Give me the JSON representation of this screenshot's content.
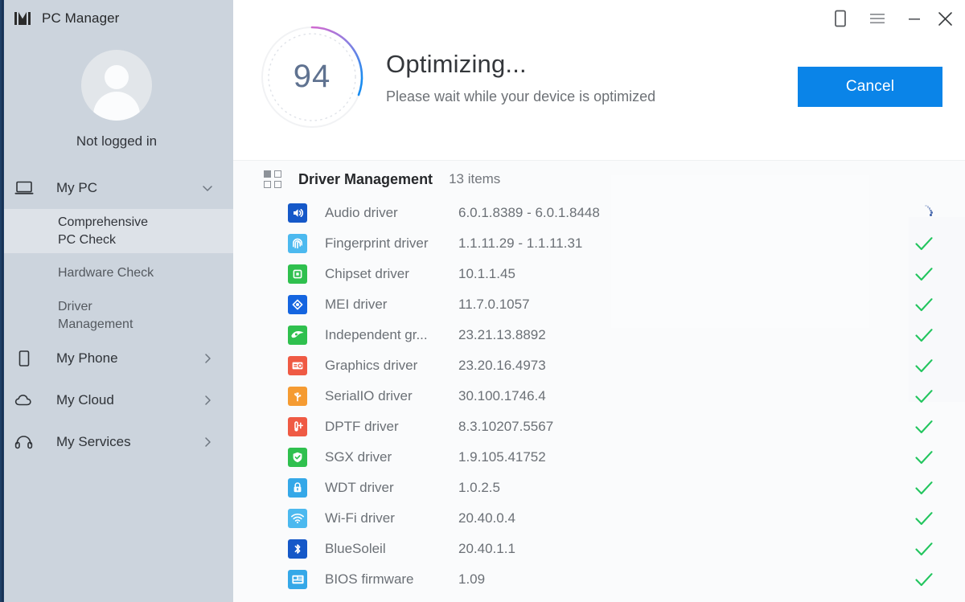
{
  "app": {
    "title": "PC Manager",
    "logo_icon": "pc-manager-logo-icon"
  },
  "window_controls": [
    {
      "name": "phone-icon",
      "label": "Phone"
    },
    {
      "name": "menu-icon",
      "label": "Menu"
    },
    {
      "name": "minimize-icon",
      "label": "Minimize"
    },
    {
      "name": "close-icon",
      "label": "Close"
    }
  ],
  "sidebar": {
    "profile": {
      "avatar_icon": "default-user-avatar",
      "status_text": "Not logged in"
    },
    "items": [
      {
        "label": "My PC",
        "icon": "laptop-icon",
        "chevron": "chevron-down-icon",
        "expanded": true,
        "children": [
          {
            "label": "Comprehensive PC Check",
            "active": true
          },
          {
            "label": "Hardware Check",
            "active": false
          },
          {
            "label": "Driver Management",
            "active": false
          }
        ]
      },
      {
        "label": "My Phone",
        "icon": "phone-icon",
        "chevron": "chevron-right-icon",
        "expanded": false,
        "children": []
      },
      {
        "label": "My Cloud",
        "icon": "cloud-icon",
        "chevron": "chevron-right-icon",
        "expanded": false,
        "children": []
      },
      {
        "label": "My Services",
        "icon": "headset-icon",
        "chevron": "chevron-right-icon",
        "expanded": false,
        "children": []
      }
    ]
  },
  "header": {
    "score": "94",
    "title": "Optimizing...",
    "subtitle": "Please wait while your device is optimized",
    "cancel_label": "Cancel",
    "accent_color": "#0a84e8",
    "ring_gradient_from": "#d06bd0",
    "ring_gradient_to": "#1a8cf0"
  },
  "content": {
    "section_icon": "grid-icon",
    "section_title": "Driver Management",
    "item_count": "13 items",
    "status_done_color": "#22c55e",
    "status_loading_color": "#3b5ea8",
    "rows": [
      {
        "name": "Audio driver",
        "version": "6.0.1.8389 - 6.0.1.8448",
        "status": "loading",
        "icon": "speaker-icon",
        "icon_color": "#1558c8"
      },
      {
        "name": "Fingerprint driver",
        "version": "1.1.11.29 - 1.1.11.31",
        "status": "done",
        "icon": "fingerprint-icon",
        "icon_color": "#4cb9ef"
      },
      {
        "name": "Chipset driver",
        "version": "10.1.1.45",
        "status": "done",
        "icon": "chipset-icon",
        "icon_color": "#2fc04e"
      },
      {
        "name": "MEI driver",
        "version": "11.7.0.1057",
        "status": "done",
        "icon": "mei-icon",
        "icon_color": "#1565e0"
      },
      {
        "name": "Independent gr...",
        "version": "23.21.13.8892",
        "status": "done",
        "icon": "gpu-icon",
        "icon_color": "#2fc04e"
      },
      {
        "name": "Graphics driver",
        "version": "23.20.16.4973",
        "status": "done",
        "icon": "graphics-icon",
        "icon_color": "#ef5a44"
      },
      {
        "name": "SerialIO driver",
        "version": "30.100.1746.4",
        "status": "done",
        "icon": "usb-icon",
        "icon_color": "#f59b32"
      },
      {
        "name": "DPTF driver",
        "version": "8.3.10207.5567",
        "status": "done",
        "icon": "thermometer-icon",
        "icon_color": "#ef5a44"
      },
      {
        "name": "SGX driver",
        "version": "1.9.105.41752",
        "status": "done",
        "icon": "shield-check-icon",
        "icon_color": "#2fc04e"
      },
      {
        "name": "WDT driver",
        "version": "1.0.2.5",
        "status": "done",
        "icon": "lock-icon",
        "icon_color": "#35a8e8"
      },
      {
        "name": "Wi-Fi driver",
        "version": "20.40.0.4",
        "status": "done",
        "icon": "wifi-icon",
        "icon_color": "#4cb9ef"
      },
      {
        "name": "BlueSoleil",
        "version": "20.40.1.1",
        "status": "done",
        "icon": "bluetooth-icon",
        "icon_color": "#1558c8"
      },
      {
        "name": "BIOS firmware",
        "version": "1.09",
        "status": "done",
        "icon": "bios-icon",
        "icon_color": "#35a8e8"
      }
    ]
  }
}
